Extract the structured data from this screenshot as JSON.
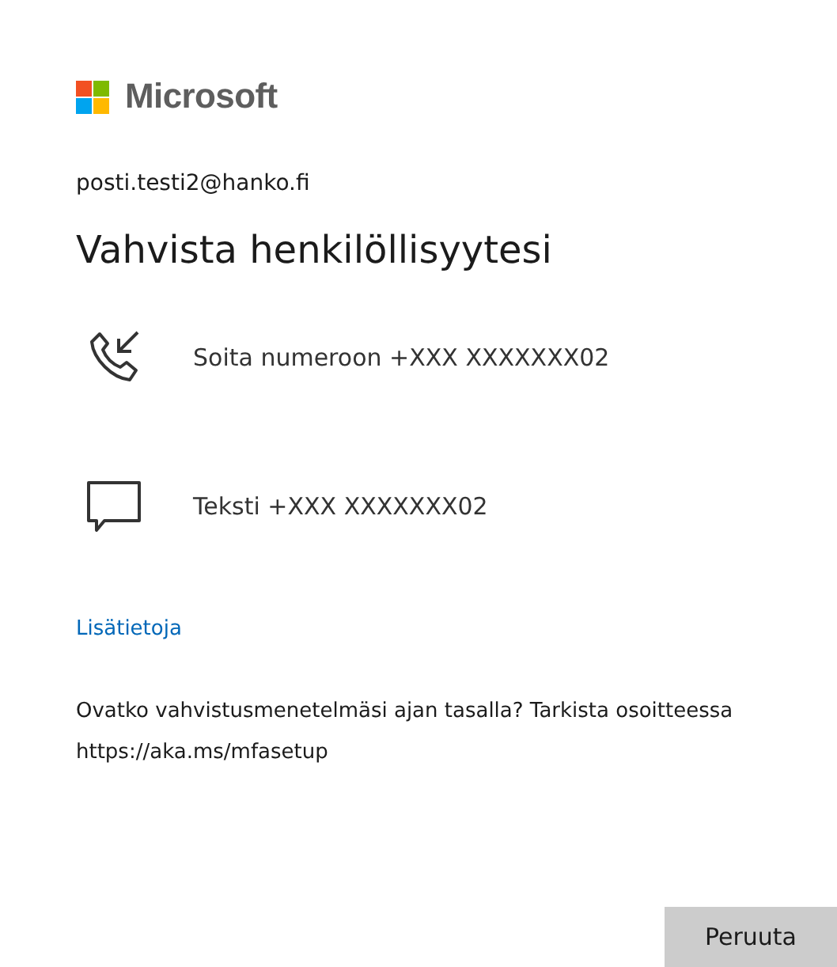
{
  "brand": {
    "name": "Microsoft"
  },
  "account": "posti.testi2@hanko.fi",
  "title": "Vahvista henkilöllisyytesi",
  "options": [
    {
      "kind": "call",
      "label": "Soita numeroon +XXX XXXXXXX02"
    },
    {
      "kind": "text",
      "label": "Teksti +XXX XXXXXXX02"
    }
  ],
  "more_info_link": "Lisätietoja",
  "note": "Ovatko vahvistusmenetelmäsi ajan tasalla? Tarkista osoitteessa https://aka.ms/mfasetup",
  "buttons": [
    "Peruuta"
  ]
}
